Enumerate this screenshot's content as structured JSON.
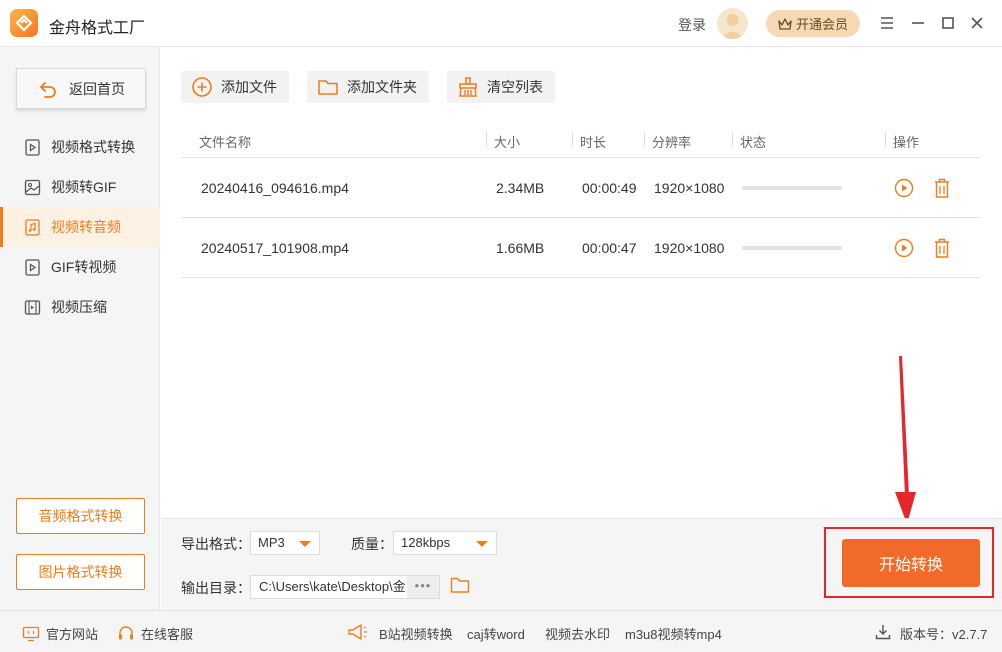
{
  "app": {
    "title": "金舟格式工厂",
    "login_label": "登录",
    "vip_label": "开通会员"
  },
  "sidebar": {
    "back_label": "返回首页",
    "items": [
      {
        "label": "视频格式转换",
        "icon": "play-file-icon"
      },
      {
        "label": "视频转GIF",
        "icon": "image-icon"
      },
      {
        "label": "视频转音频",
        "icon": "music-file-icon",
        "active": true
      },
      {
        "label": "GIF转视频",
        "icon": "play-file-icon"
      },
      {
        "label": "视频压缩",
        "icon": "compress-icon"
      }
    ],
    "bottom_buttons": [
      "音频格式转换",
      "图片格式转换"
    ]
  },
  "toolbar": {
    "add_file": "添加文件",
    "add_folder": "添加文件夹",
    "clear_list": "清空列表"
  },
  "table": {
    "headers": [
      "文件名称",
      "大小",
      "时长",
      "分辨率",
      "状态",
      "操作"
    ],
    "rows": [
      {
        "name": "20240416_094616.mp4",
        "size": "2.34MB",
        "duration": "00:00:49",
        "resolution": "1920×1080",
        "progress": 0
      },
      {
        "name": "20240517_101908.mp4",
        "size": "1.66MB",
        "duration": "00:00:47",
        "resolution": "1920×1080",
        "progress": 0
      }
    ]
  },
  "settings": {
    "format_label": "导出格式：",
    "format_value": "MP3",
    "quality_label": "质量：",
    "quality_value": "128kbps",
    "output_label": "输出目录：",
    "output_path": "C:\\Users\\kate\\Desktop\\金",
    "more": "•••"
  },
  "start_label": "开始转换",
  "footer": {
    "website": "官方网站",
    "support": "在线客服",
    "links": [
      "B站视频转换",
      "caj转word",
      "视频去水印",
      "m3u8视频转mp4"
    ],
    "version": "版本号：v2.7.7"
  },
  "colors": {
    "accent": "#f07c1d",
    "start_button": "#f26a2a",
    "annotation_red": "#e5262a"
  }
}
